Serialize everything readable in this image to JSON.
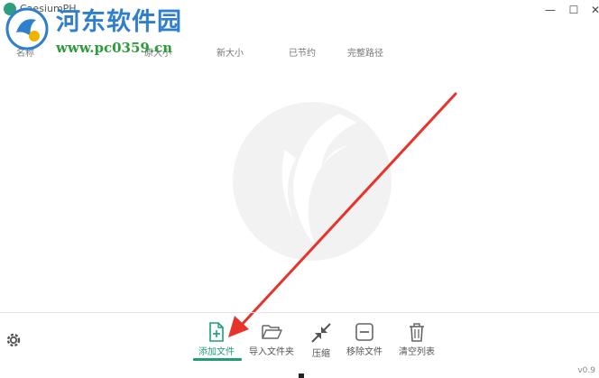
{
  "app": {
    "title": "CaesiumPH",
    "version": "v0.9"
  },
  "watermark": {
    "site_name": "河东软件园",
    "url": "www.pc0359.cn"
  },
  "columns": {
    "name": "名称",
    "original_size": "原大小",
    "new_size": "新大小",
    "saved": "已节约",
    "full_path": "完整路径"
  },
  "toolbar": {
    "add_file": "添加文件",
    "import_folder": "导入文件夹",
    "compress": "压缩",
    "remove_file": "移除文件",
    "clear_list": "清空列表"
  },
  "window_controls": {
    "minimize": "—",
    "maximize": "☐",
    "close": "✕"
  },
  "colors": {
    "accent": "#1f9d78",
    "arrow": "#e8332a",
    "watermark_blue": "#2f7fcf",
    "watermark_green": "#2d9a3c"
  },
  "icons": [
    "app-logo-icon",
    "settings-gear-icon",
    "add-file-icon",
    "open-folder-icon",
    "compress-arrows-icon",
    "remove-minus-icon",
    "trash-icon"
  ]
}
